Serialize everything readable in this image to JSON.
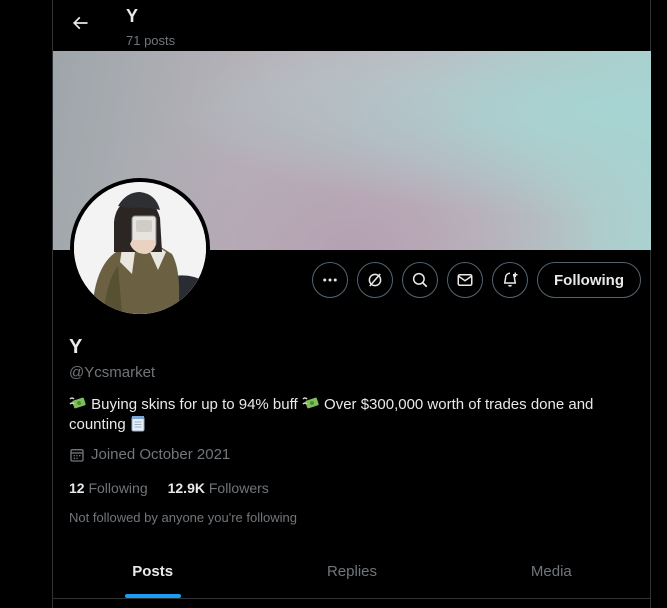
{
  "header": {
    "title": "Y",
    "post_count": "71 posts"
  },
  "profile": {
    "display_name": "Y",
    "handle": "@Ycsmarket",
    "bio_part1": "Buying skins for up to 94% buff",
    "bio_part2": "Over $300,000 worth of trades done and counting",
    "joined": "Joined October 2021",
    "following_count": "12",
    "following_label": "Following",
    "followers_count": "12.9K",
    "followers_label": "Followers",
    "mutuals_note": "Not followed by anyone you're following"
  },
  "actions": {
    "more_icon": "more-horizontal-icon",
    "grok_icon": "grok-icon",
    "search_icon": "search-icon",
    "message_icon": "mail-icon",
    "notify_icon": "bell-plus-icon",
    "follow_button_label": "Following"
  },
  "tabs": [
    {
      "label": "Posts",
      "active": true
    },
    {
      "label": "Replies",
      "active": false
    },
    {
      "label": "Media",
      "active": false
    }
  ],
  "colors": {
    "background": "#000000",
    "text_primary": "#e7e9ea",
    "text_secondary": "#71767b",
    "accent": "#1d9bf0",
    "border": "#2f3336"
  }
}
